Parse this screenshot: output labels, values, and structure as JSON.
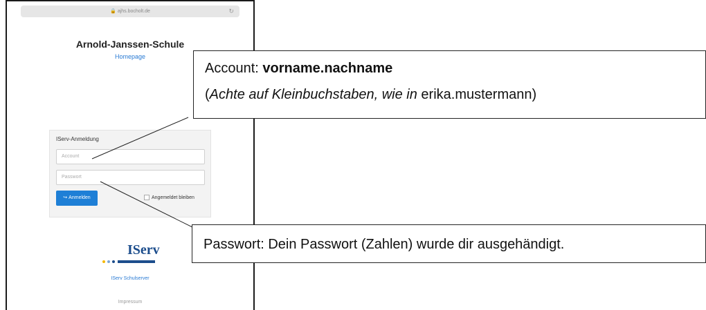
{
  "browser": {
    "url": "ajhs.bocholt.de",
    "lock_glyph": "🔒",
    "reload_glyph": "↻"
  },
  "page": {
    "school_title": "Arnold-Janssen-Schule",
    "homepage_link": "Homepage"
  },
  "login": {
    "heading": "IServ-Anmeldung",
    "account_placeholder": "Account",
    "password_placeholder": "Passwort",
    "submit_label": "Anmelden",
    "submit_icon": "↪",
    "remember_label": "Angemeldet bleiben"
  },
  "footer": {
    "logo_text": "IServ",
    "logo_dot_colors": [
      "#f5b800",
      "#7aa6d8",
      "#1c4d8c"
    ],
    "subtitle": "IServ Schulserver",
    "impressum": "Impressum"
  },
  "callouts": {
    "account": {
      "prefix": "Account: ",
      "username_format": "vorname.nachname",
      "line2_open": "(",
      "line2_italic": "Achte auf Kleinbuchstaben, wie in",
      "line2_example": " erika.mustermann)"
    },
    "password": {
      "text": "Passwort: Dein Passwort (Zahlen) wurde dir ausgehändigt."
    }
  }
}
